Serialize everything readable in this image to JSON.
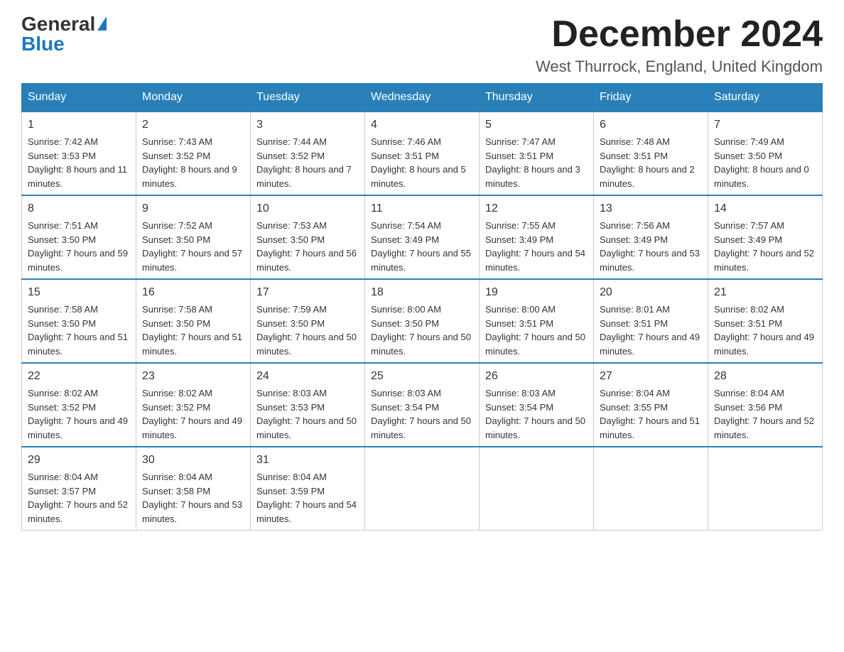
{
  "logo": {
    "general": "General",
    "blue": "Blue",
    "triangle": "▶"
  },
  "title": {
    "month": "December 2024",
    "location": "West Thurrock, England, United Kingdom"
  },
  "headers": [
    "Sunday",
    "Monday",
    "Tuesday",
    "Wednesday",
    "Thursday",
    "Friday",
    "Saturday"
  ],
  "weeks": [
    [
      {
        "day": "1",
        "sunrise": "Sunrise: 7:42 AM",
        "sunset": "Sunset: 3:53 PM",
        "daylight": "Daylight: 8 hours and 11 minutes."
      },
      {
        "day": "2",
        "sunrise": "Sunrise: 7:43 AM",
        "sunset": "Sunset: 3:52 PM",
        "daylight": "Daylight: 8 hours and 9 minutes."
      },
      {
        "day": "3",
        "sunrise": "Sunrise: 7:44 AM",
        "sunset": "Sunset: 3:52 PM",
        "daylight": "Daylight: 8 hours and 7 minutes."
      },
      {
        "day": "4",
        "sunrise": "Sunrise: 7:46 AM",
        "sunset": "Sunset: 3:51 PM",
        "daylight": "Daylight: 8 hours and 5 minutes."
      },
      {
        "day": "5",
        "sunrise": "Sunrise: 7:47 AM",
        "sunset": "Sunset: 3:51 PM",
        "daylight": "Daylight: 8 hours and 3 minutes."
      },
      {
        "day": "6",
        "sunrise": "Sunrise: 7:48 AM",
        "sunset": "Sunset: 3:51 PM",
        "daylight": "Daylight: 8 hours and 2 minutes."
      },
      {
        "day": "7",
        "sunrise": "Sunrise: 7:49 AM",
        "sunset": "Sunset: 3:50 PM",
        "daylight": "Daylight: 8 hours and 0 minutes."
      }
    ],
    [
      {
        "day": "8",
        "sunrise": "Sunrise: 7:51 AM",
        "sunset": "Sunset: 3:50 PM",
        "daylight": "Daylight: 7 hours and 59 minutes."
      },
      {
        "day": "9",
        "sunrise": "Sunrise: 7:52 AM",
        "sunset": "Sunset: 3:50 PM",
        "daylight": "Daylight: 7 hours and 57 minutes."
      },
      {
        "day": "10",
        "sunrise": "Sunrise: 7:53 AM",
        "sunset": "Sunset: 3:50 PM",
        "daylight": "Daylight: 7 hours and 56 minutes."
      },
      {
        "day": "11",
        "sunrise": "Sunrise: 7:54 AM",
        "sunset": "Sunset: 3:49 PM",
        "daylight": "Daylight: 7 hours and 55 minutes."
      },
      {
        "day": "12",
        "sunrise": "Sunrise: 7:55 AM",
        "sunset": "Sunset: 3:49 PM",
        "daylight": "Daylight: 7 hours and 54 minutes."
      },
      {
        "day": "13",
        "sunrise": "Sunrise: 7:56 AM",
        "sunset": "Sunset: 3:49 PM",
        "daylight": "Daylight: 7 hours and 53 minutes."
      },
      {
        "day": "14",
        "sunrise": "Sunrise: 7:57 AM",
        "sunset": "Sunset: 3:49 PM",
        "daylight": "Daylight: 7 hours and 52 minutes."
      }
    ],
    [
      {
        "day": "15",
        "sunrise": "Sunrise: 7:58 AM",
        "sunset": "Sunset: 3:50 PM",
        "daylight": "Daylight: 7 hours and 51 minutes."
      },
      {
        "day": "16",
        "sunrise": "Sunrise: 7:58 AM",
        "sunset": "Sunset: 3:50 PM",
        "daylight": "Daylight: 7 hours and 51 minutes."
      },
      {
        "day": "17",
        "sunrise": "Sunrise: 7:59 AM",
        "sunset": "Sunset: 3:50 PM",
        "daylight": "Daylight: 7 hours and 50 minutes."
      },
      {
        "day": "18",
        "sunrise": "Sunrise: 8:00 AM",
        "sunset": "Sunset: 3:50 PM",
        "daylight": "Daylight: 7 hours and 50 minutes."
      },
      {
        "day": "19",
        "sunrise": "Sunrise: 8:00 AM",
        "sunset": "Sunset: 3:51 PM",
        "daylight": "Daylight: 7 hours and 50 minutes."
      },
      {
        "day": "20",
        "sunrise": "Sunrise: 8:01 AM",
        "sunset": "Sunset: 3:51 PM",
        "daylight": "Daylight: 7 hours and 49 minutes."
      },
      {
        "day": "21",
        "sunrise": "Sunrise: 8:02 AM",
        "sunset": "Sunset: 3:51 PM",
        "daylight": "Daylight: 7 hours and 49 minutes."
      }
    ],
    [
      {
        "day": "22",
        "sunrise": "Sunrise: 8:02 AM",
        "sunset": "Sunset: 3:52 PM",
        "daylight": "Daylight: 7 hours and 49 minutes."
      },
      {
        "day": "23",
        "sunrise": "Sunrise: 8:02 AM",
        "sunset": "Sunset: 3:52 PM",
        "daylight": "Daylight: 7 hours and 49 minutes."
      },
      {
        "day": "24",
        "sunrise": "Sunrise: 8:03 AM",
        "sunset": "Sunset: 3:53 PM",
        "daylight": "Daylight: 7 hours and 50 minutes."
      },
      {
        "day": "25",
        "sunrise": "Sunrise: 8:03 AM",
        "sunset": "Sunset: 3:54 PM",
        "daylight": "Daylight: 7 hours and 50 minutes."
      },
      {
        "day": "26",
        "sunrise": "Sunrise: 8:03 AM",
        "sunset": "Sunset: 3:54 PM",
        "daylight": "Daylight: 7 hours and 50 minutes."
      },
      {
        "day": "27",
        "sunrise": "Sunrise: 8:04 AM",
        "sunset": "Sunset: 3:55 PM",
        "daylight": "Daylight: 7 hours and 51 minutes."
      },
      {
        "day": "28",
        "sunrise": "Sunrise: 8:04 AM",
        "sunset": "Sunset: 3:56 PM",
        "daylight": "Daylight: 7 hours and 52 minutes."
      }
    ],
    [
      {
        "day": "29",
        "sunrise": "Sunrise: 8:04 AM",
        "sunset": "Sunset: 3:57 PM",
        "daylight": "Daylight: 7 hours and 52 minutes."
      },
      {
        "day": "30",
        "sunrise": "Sunrise: 8:04 AM",
        "sunset": "Sunset: 3:58 PM",
        "daylight": "Daylight: 7 hours and 53 minutes."
      },
      {
        "day": "31",
        "sunrise": "Sunrise: 8:04 AM",
        "sunset": "Sunset: 3:59 PM",
        "daylight": "Daylight: 7 hours and 54 minutes."
      },
      null,
      null,
      null,
      null
    ]
  ]
}
